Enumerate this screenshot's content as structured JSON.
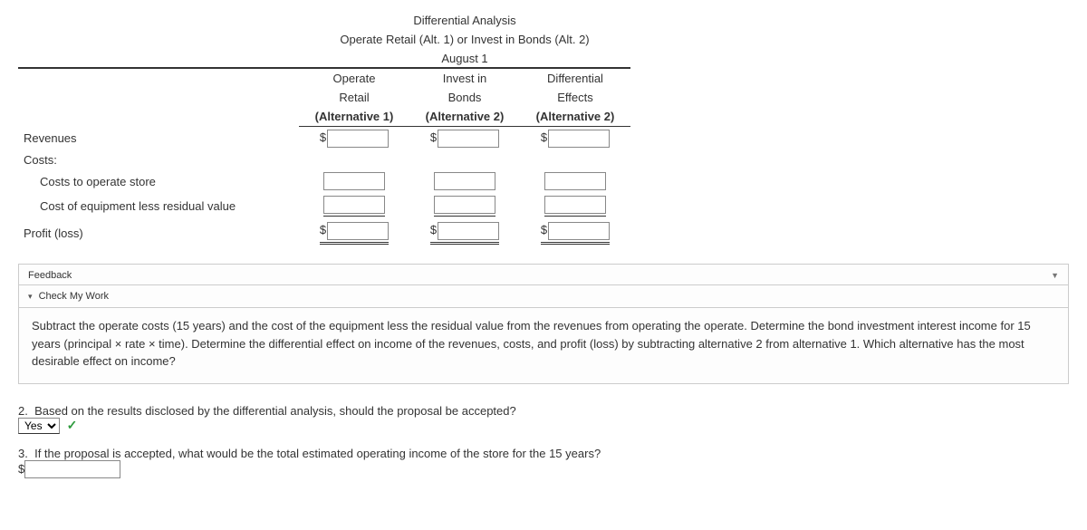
{
  "table": {
    "title": "Differential Analysis",
    "subtitle": "Operate Retail (Alt. 1) or Invest in Bonds (Alt. 2)",
    "date": "August 1",
    "columns": [
      {
        "line1": "Operate",
        "line2": "Retail",
        "line3": "(Alternative 1)"
      },
      {
        "line1": "Invest in",
        "line2": "Bonds",
        "line3": "(Alternative 2)"
      },
      {
        "line1": "Differential",
        "line2": "Effects",
        "line3": "(Alternative 2)"
      }
    ],
    "rows": {
      "revenues": "Revenues",
      "costs": "Costs:",
      "cost_store": "Costs to operate store",
      "cost_equip": "Cost of equipment less residual value",
      "profit": "Profit (loss)"
    },
    "currency": "$"
  },
  "feedback": {
    "title": "Feedback",
    "sub": "Check My Work",
    "body": "Subtract the operate costs (15 years) and the cost of the equipment less the residual value from the revenues from operating the operate. Determine the bond investment interest income for 15 years (principal × rate × time). Determine the differential effect on income of the revenues, costs, and profit (loss) by subtracting alternative 2 from alternative 1. Which alternative has the most desirable effect on income?"
  },
  "q2": {
    "num": "2.",
    "text": "Based on the results disclosed by the differential analysis, should the proposal be accepted?",
    "answer": "Yes"
  },
  "q3": {
    "num": "3.",
    "text": "If the proposal is accepted, what would be the total estimated operating income of the store for the 15 years?",
    "currency": "$"
  }
}
